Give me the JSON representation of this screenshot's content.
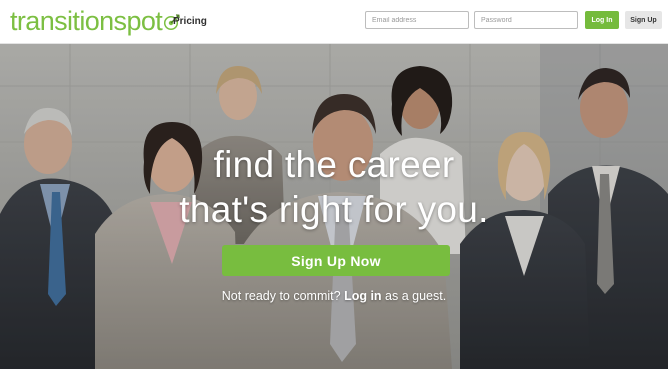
{
  "header": {
    "logo_text": "transitionspot",
    "nav": {
      "pricing_label": "Pricing"
    },
    "email_input": {
      "placeholder": "Email address",
      "value": ""
    },
    "password_input": {
      "placeholder": "Password",
      "value": ""
    },
    "login_label": "Log In",
    "signup_label": "Sign Up"
  },
  "hero": {
    "headline_line1": "find the career",
    "headline_line2": "that's right for you.",
    "cta_label": "Sign Up Now",
    "guest_prefix": "Not ready to commit?",
    "guest_link": "Log in",
    "guest_suffix": "as a guest."
  },
  "colors": {
    "brand_green": "#7cbf42",
    "button_green": "#78bd3f",
    "secondary_button": "#e6e6e6"
  },
  "icons": {
    "logo_mark": "target-icon"
  }
}
